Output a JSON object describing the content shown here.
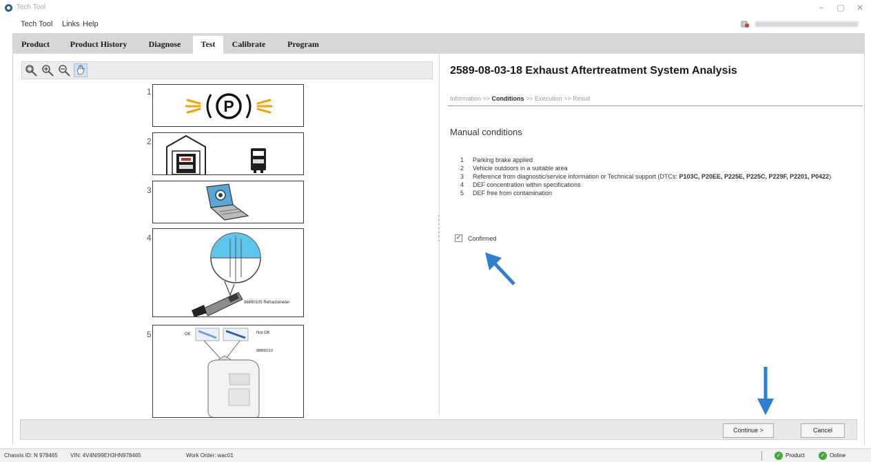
{
  "window": {
    "title": "Tech Tool",
    "controls": {
      "minimize": "–",
      "maximize": "▢",
      "close": "✕"
    }
  },
  "menu": {
    "items": [
      "Tech Tool",
      "Links",
      "Help"
    ]
  },
  "tabs": [
    {
      "label": "Product",
      "active": false
    },
    {
      "label": "Product History",
      "active": false
    },
    {
      "label": "Diagnose",
      "active": false
    },
    {
      "label": "Test",
      "active": true
    },
    {
      "label": "Calibrate",
      "active": false
    },
    {
      "label": "Program",
      "active": false
    }
  ],
  "image_toolbar": {
    "tools": [
      "zoom-fit-icon",
      "zoom-in-icon",
      "zoom-out-icon",
      "pan-hand-icon"
    ],
    "active_tool": "pan-hand-icon"
  },
  "steps": [
    {
      "number": "1",
      "icon": "parking-brake-icon"
    },
    {
      "number": "2",
      "icon": "vehicle-outdoors-icon"
    },
    {
      "number": "3",
      "icon": "laptop-support-icon"
    },
    {
      "number": "4",
      "icon": "refractometer-icon",
      "caption": "88890105 Refractometer"
    },
    {
      "number": "5",
      "icon": "def-container-icon",
      "ok_label": "OK",
      "not_ok_label": "Not OK",
      "part_number": "88890110"
    }
  ],
  "test": {
    "title": "2589-08-03-18 Exhaust Aftertreatment System Analysis",
    "breadcrumb": {
      "information": "Information",
      "sep1": " >> ",
      "conditions": "Conditions",
      "sep2": " >> ",
      "execution": "Execution",
      "sep3": " >> ",
      "result": "Result",
      "current": "Conditions"
    },
    "section_title": "Manual conditions",
    "conditions": [
      {
        "num": "1",
        "text": "Parking brake applied",
        "bold": "",
        "tail": ""
      },
      {
        "num": "2",
        "text": "Vehicle outdoors in a suitable area",
        "bold": "",
        "tail": ""
      },
      {
        "num": "3",
        "text": "Reference from diagnostic/service information or Technical support (DTCs: ",
        "bold": "P103C, P20EE, P225E, P225C, P229F, P2201, P0422",
        "tail": ")"
      },
      {
        "num": "4",
        "text": "DEF concentration within specifications",
        "bold": "",
        "tail": ""
      },
      {
        "num": "5",
        "text": "DEF free from contamination",
        "bold": "",
        "tail": ""
      }
    ],
    "confirmed_label": "Confirmed",
    "confirmed_checked": true,
    "checkmark": "✓"
  },
  "buttons": {
    "continue": "Continue >",
    "cancel": "Cancel"
  },
  "status": {
    "chassis": "Chassis ID: N 978465",
    "vin": "VIN: 4V4NI99EH3HN978465",
    "work_order": "Work Order: wac01",
    "product": "Product",
    "online": "Online",
    "indicator_color": "#47a834"
  },
  "colors": {
    "annotation_arrow": "#2f7fd1",
    "tab_bar": "#d7d7d7"
  }
}
